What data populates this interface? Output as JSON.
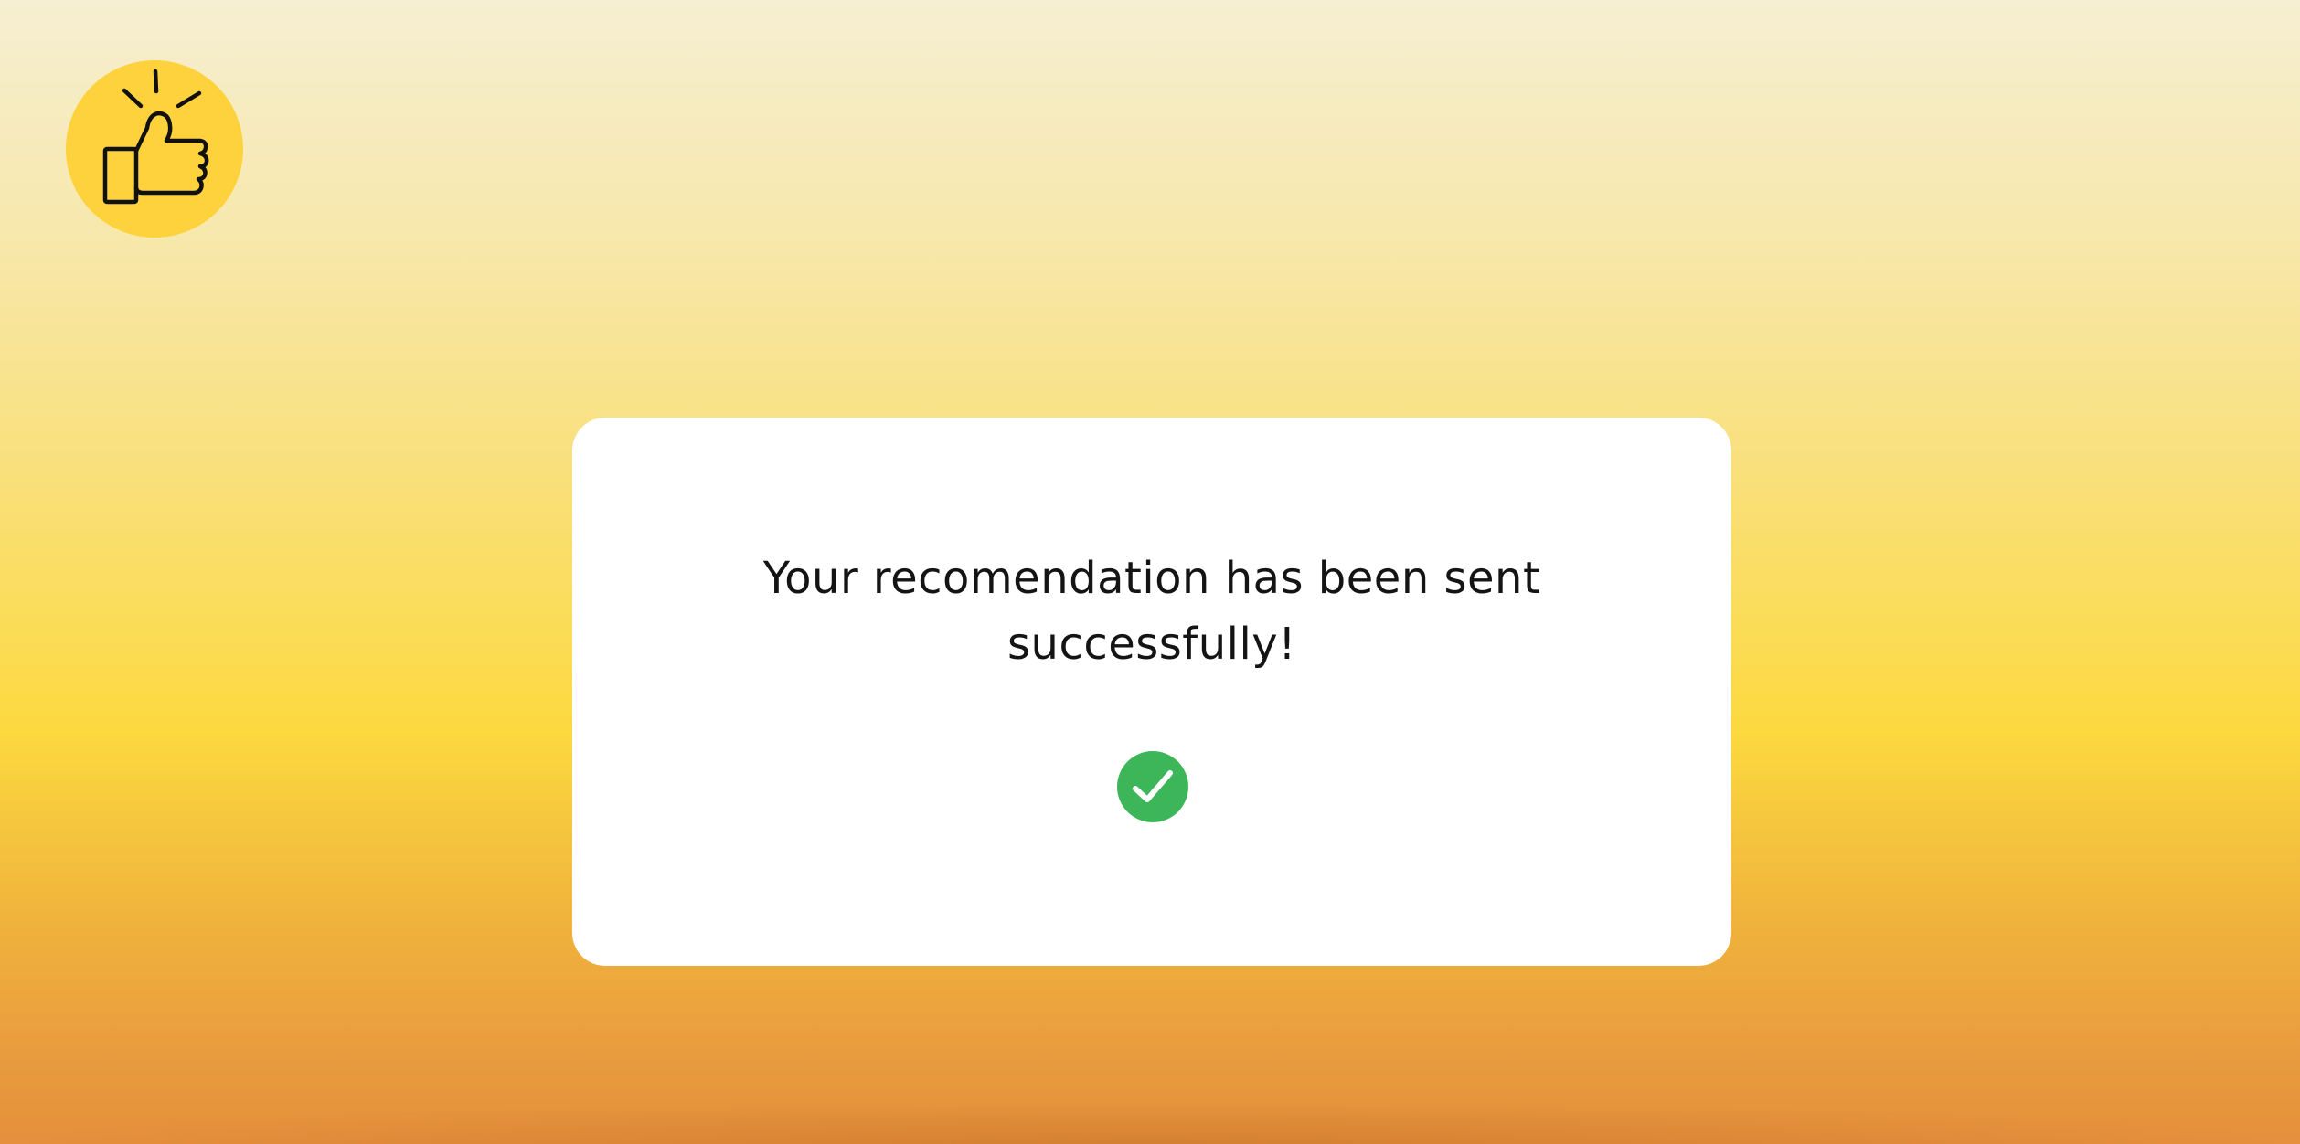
{
  "logo": {
    "icon": "thumbs-up-icon",
    "background_color": "#fdd23c"
  },
  "dialog": {
    "message": "Your recomendation has been sent successfully!",
    "status_icon": "check-circle-icon",
    "status_color": "#3db659"
  }
}
